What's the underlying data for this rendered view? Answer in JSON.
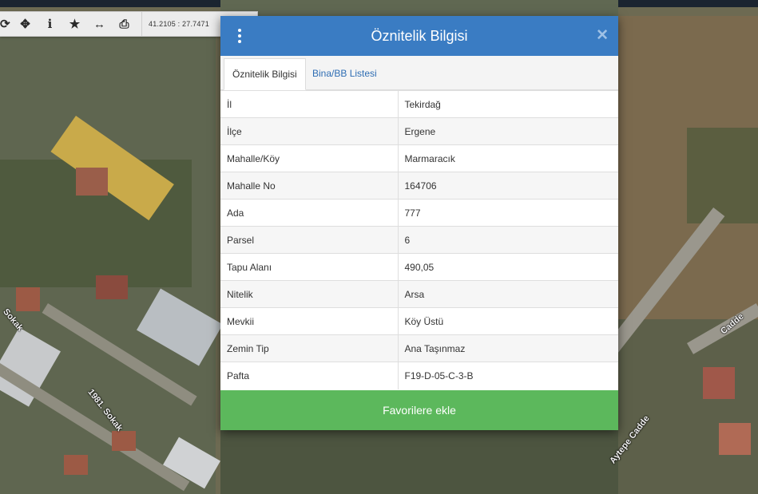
{
  "toolbar": {
    "buttons": [
      {
        "name": "refresh-icon",
        "glyph": "⟳"
      },
      {
        "name": "move-icon",
        "glyph": "✥"
      },
      {
        "name": "info-icon",
        "glyph": "i"
      },
      {
        "name": "star-icon",
        "glyph": "★"
      },
      {
        "name": "measure-icon",
        "glyph": "↔"
      },
      {
        "name": "print-icon",
        "glyph": "⎙"
      }
    ],
    "coordinates": "41.2105 : 27.7471"
  },
  "map_labels": {
    "sokak_left": "Sokak",
    "sokak_1981": "1981. Sokak",
    "cadde_right": "Cadde",
    "aytepe_cadde": "Aytepe Cadde"
  },
  "modal": {
    "title": "Öznitelik Bilgisi",
    "close_glyph": "✕",
    "tabs": [
      {
        "label": "Öznitelik Bilgisi",
        "active": true
      },
      {
        "label": "Bina/BB Listesi",
        "active": false
      }
    ],
    "rows": [
      {
        "key": "İl",
        "value": "Tekirdağ"
      },
      {
        "key": "İlçe",
        "value": "Ergene"
      },
      {
        "key": "Mahalle/Köy",
        "value": "Marmaracık"
      },
      {
        "key": "Mahalle No",
        "value": "164706"
      },
      {
        "key": "Ada",
        "value": "777"
      },
      {
        "key": "Parsel",
        "value": "6"
      },
      {
        "key": "Tapu Alanı",
        "value": "490,05"
      },
      {
        "key": "Nitelik",
        "value": "Arsa"
      },
      {
        "key": "Mevkii",
        "value": "Köy Üstü"
      },
      {
        "key": "Zemin Tip",
        "value": "Ana Taşınmaz"
      },
      {
        "key": "Pafta",
        "value": "F19-D-05-C-3-B"
      }
    ],
    "favorite_label": "Favorilere ekle"
  },
  "colors": {
    "header": "#3a7cc3",
    "favorite": "#5cb85c",
    "tab_link": "#2e6db3"
  }
}
